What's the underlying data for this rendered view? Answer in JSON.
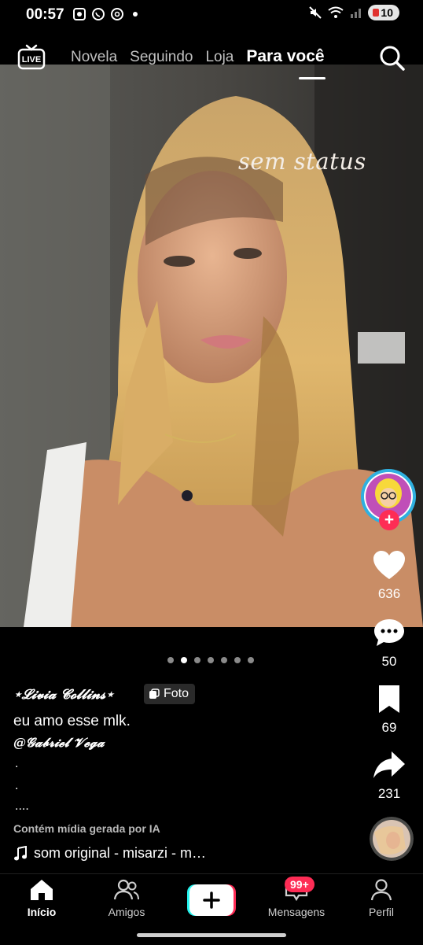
{
  "status_bar": {
    "time": "00:57",
    "battery": "10"
  },
  "top_nav": {
    "live_label": "LIVE",
    "tabs": [
      "Novela",
      "Seguindo",
      "Loja",
      "Para você"
    ]
  },
  "post": {
    "overlay_text": "sem status",
    "author": "⋆𝓛𝓲𝓿𝓲𝓪 𝓒𝓸𝓵𝓵𝓲𝓷𝓼⋆",
    "badge": "Foto",
    "description": "eu amo esse mlk.",
    "mention": "@𝓖𝓪𝓫𝓻𝓲𝓮𝓵 𝓥𝓮𝓰𝓪",
    "dot_lines": [
      ".",
      ".",
      "...."
    ],
    "ai_note": "Contém mídia gerada por IA",
    "music": "som original - misarzi - m…",
    "pagination": {
      "total": 7,
      "active": 1
    }
  },
  "rail": {
    "likes": "636",
    "comments": "50",
    "saves": "69",
    "shares": "231"
  },
  "bottom_nav": {
    "home": "Início",
    "friends": "Amigos",
    "messages": "Mensagens",
    "messages_badge": "99+",
    "profile": "Perfil"
  },
  "colors": {
    "accent": "#fe2c55",
    "create_left": "#25f4ee",
    "create_right": "#fe2c55"
  }
}
